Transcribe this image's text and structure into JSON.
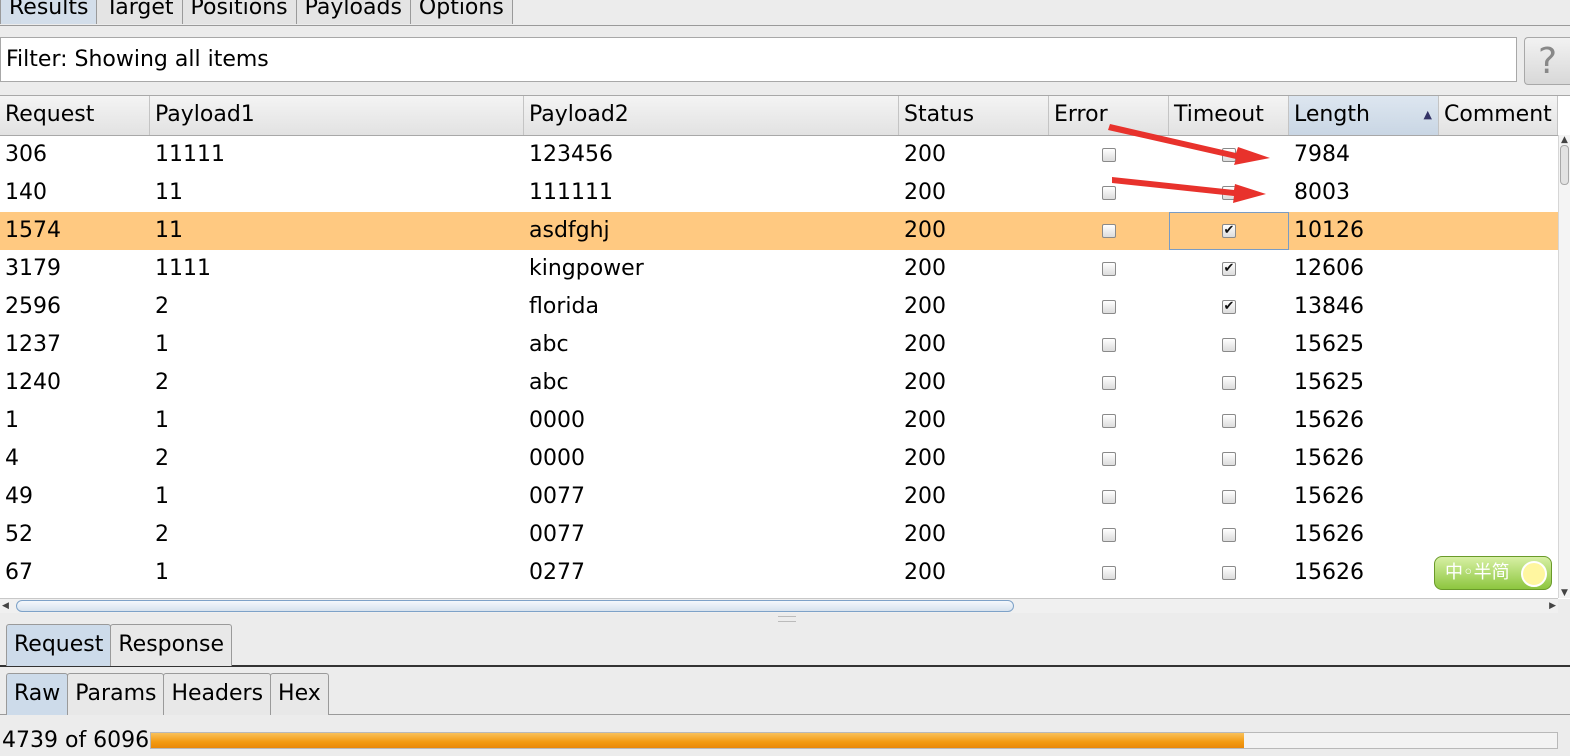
{
  "tabs": [
    "Results",
    "Target",
    "Positions",
    "Payloads",
    "Options"
  ],
  "filter": {
    "text": "Filter: Showing all items",
    "help": "?"
  },
  "table": {
    "columns": [
      "Request",
      "Payload1",
      "Payload2",
      "Status",
      "Error",
      "Timeout",
      "Length",
      "Comment"
    ],
    "sorted_column": "Length",
    "rows": [
      {
        "request": "306",
        "payload1": "11111",
        "payload2": "123456",
        "status": "200",
        "error": false,
        "timeout": false,
        "length": "7984",
        "comment": ""
      },
      {
        "request": "140",
        "payload1": "11",
        "payload2": "111111",
        "status": "200",
        "error": false,
        "timeout": false,
        "length": "8003",
        "comment": ""
      },
      {
        "request": "1574",
        "payload1": "11",
        "payload2": "asdfghj",
        "status": "200",
        "error": false,
        "timeout": true,
        "length": "10126",
        "comment": "",
        "selected": true
      },
      {
        "request": "3179",
        "payload1": "1111",
        "payload2": "kingpower",
        "status": "200",
        "error": false,
        "timeout": true,
        "length": "12606",
        "comment": ""
      },
      {
        "request": "2596",
        "payload1": "2",
        "payload2": "florida",
        "status": "200",
        "error": false,
        "timeout": true,
        "length": "13846",
        "comment": ""
      },
      {
        "request": "1237",
        "payload1": "1",
        "payload2": "abc",
        "status": "200",
        "error": false,
        "timeout": false,
        "length": "15625",
        "comment": ""
      },
      {
        "request": "1240",
        "payload1": "2",
        "payload2": "abc",
        "status": "200",
        "error": false,
        "timeout": false,
        "length": "15625",
        "comment": ""
      },
      {
        "request": "1",
        "payload1": "1",
        "payload2": "0000",
        "status": "200",
        "error": false,
        "timeout": false,
        "length": "15626",
        "comment": ""
      },
      {
        "request": "4",
        "payload1": "2",
        "payload2": "0000",
        "status": "200",
        "error": false,
        "timeout": false,
        "length": "15626",
        "comment": ""
      },
      {
        "request": "49",
        "payload1": "1",
        "payload2": "0077",
        "status": "200",
        "error": false,
        "timeout": false,
        "length": "15626",
        "comment": ""
      },
      {
        "request": "52",
        "payload1": "2",
        "payload2": "0077",
        "status": "200",
        "error": false,
        "timeout": false,
        "length": "15626",
        "comment": ""
      },
      {
        "request": "67",
        "payload1": "1",
        "payload2": "0277",
        "status": "200",
        "error": false,
        "timeout": false,
        "length": "15626",
        "comment": ""
      }
    ]
  },
  "message_tabs": [
    "Request",
    "Response"
  ],
  "view_tabs": [
    "Raw",
    "Params",
    "Headers",
    "Hex"
  ],
  "progress": {
    "text": "4739 of 6096",
    "done": 4739,
    "total": 6096
  },
  "ime": {
    "label": "中◦半简"
  },
  "colors": {
    "selected_row": "#ffc981",
    "progress": "#f39a12",
    "annotation": "#e8322c"
  }
}
